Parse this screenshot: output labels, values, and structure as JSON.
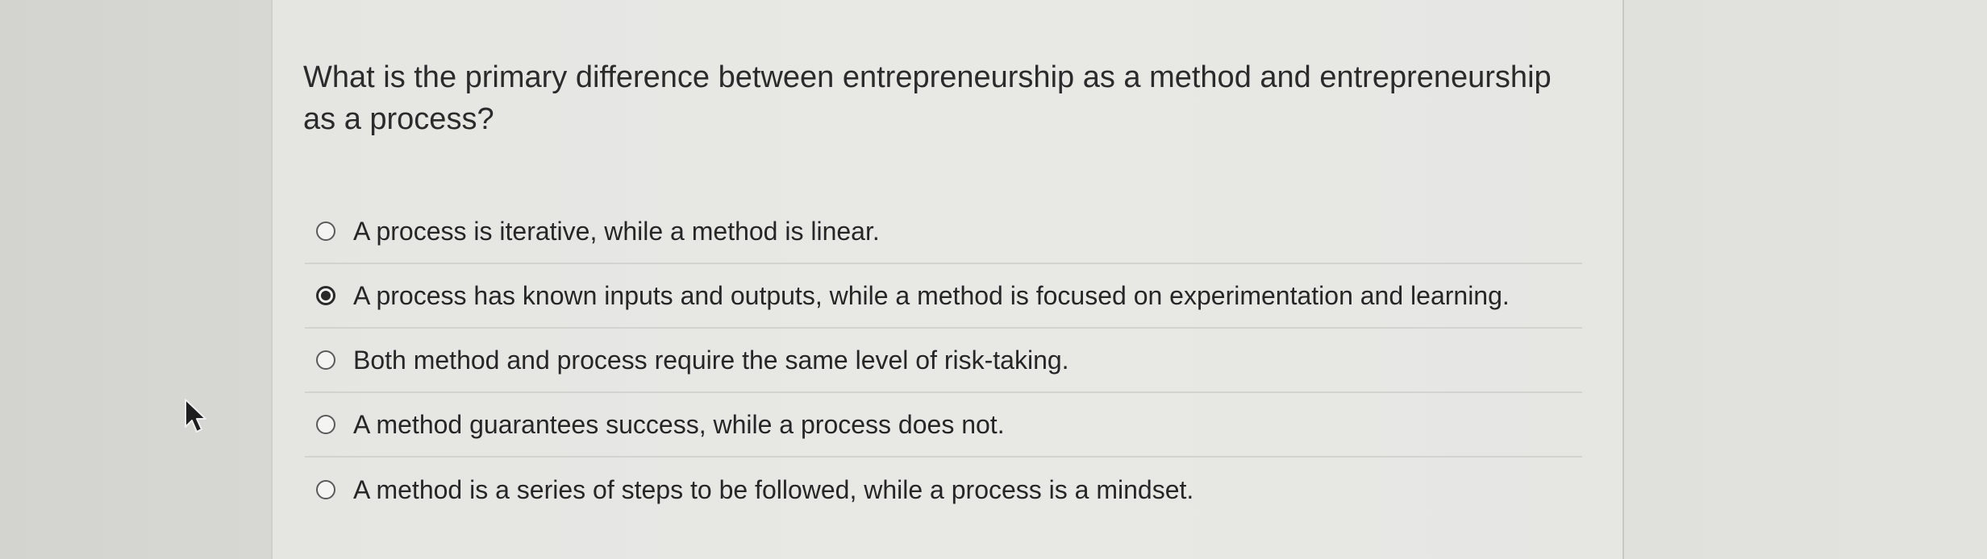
{
  "question": {
    "text": "What is the primary difference between entrepreneurship as a method and entrepreneurship as a process?"
  },
  "options": [
    {
      "label": "A process is iterative, while a method is linear.",
      "selected": false
    },
    {
      "label": "A process has known inputs and outputs, while a method is focused on experimentation and learning.",
      "selected": true
    },
    {
      "label": "Both method and process require the same level of risk-taking.",
      "selected": false
    },
    {
      "label": "A method guarantees success, while a process does not.",
      "selected": false
    },
    {
      "label": "A method is a series of steps to be followed, while a process is a mindset.",
      "selected": false
    }
  ],
  "icons": {
    "cursor": "mouse-pointer-icon",
    "radio_unchecked": "radio-unchecked-icon",
    "radio_checked": "radio-checked-icon"
  }
}
